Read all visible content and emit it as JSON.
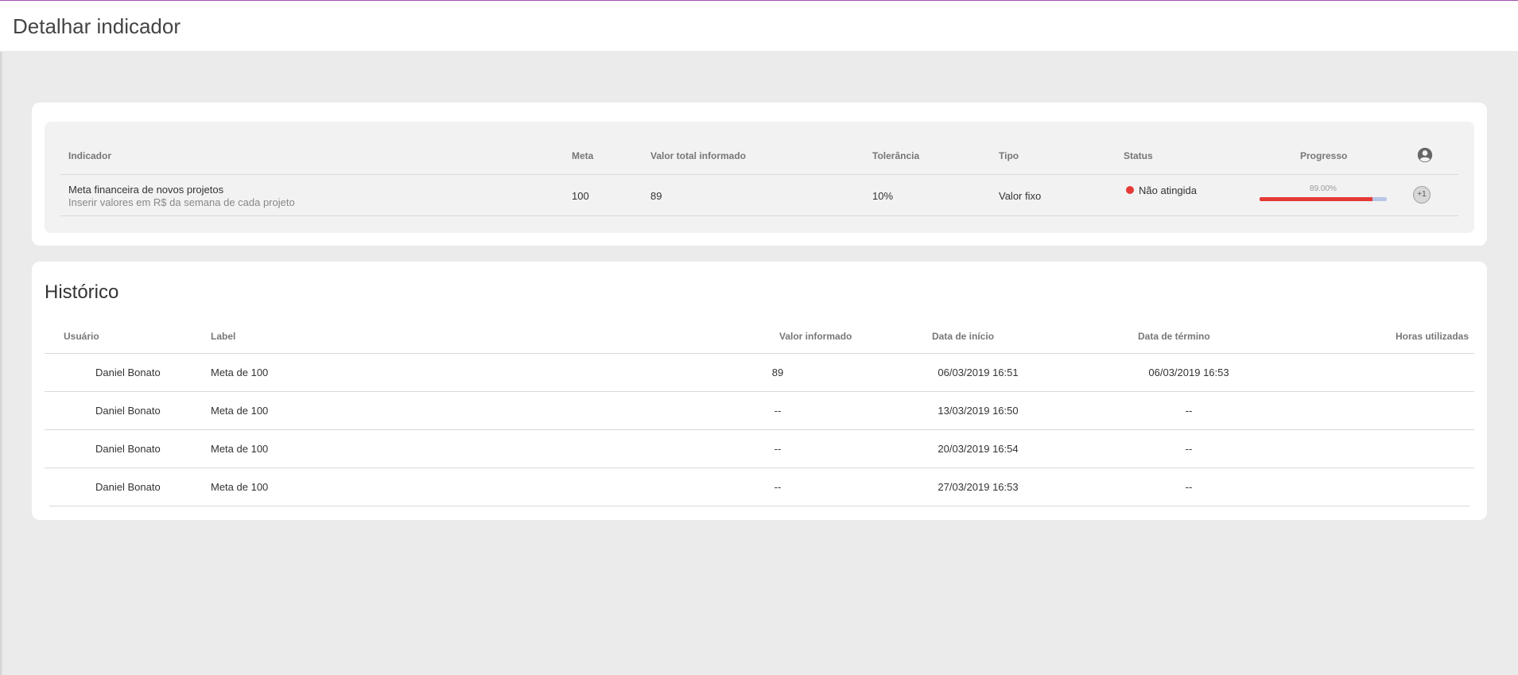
{
  "header": {
    "title": "Detalhar indicador"
  },
  "indicator_table": {
    "columns": {
      "indicador": "Indicador",
      "meta": "Meta",
      "valor_total": "Valor total informado",
      "tolerancia": "Tolerância",
      "tipo": "Tipo",
      "status": "Status",
      "progresso": "Progresso"
    },
    "row": {
      "name": "Meta financeira de novos projetos",
      "description": "Inserir valores em R$ da semana de cada projeto",
      "meta": "100",
      "valor_total": "89",
      "tolerancia": "10%",
      "tipo": "Valor fixo",
      "status": "Não atingida",
      "status_color": "#e53935",
      "progress_label": "89.00%",
      "progress_value": 0.89,
      "responsibles_extra": "+1"
    },
    "icons": {
      "responsible": "account-circle-icon"
    }
  },
  "history": {
    "title": "Histórico",
    "columns": {
      "usuario": "Usuário",
      "label": "Label",
      "valor": "Valor informado",
      "inicio": "Data de início",
      "termino": "Data de término",
      "horas": "Horas utilizadas"
    },
    "rows": [
      {
        "usuario": "Daniel Bonato",
        "label": "Meta de 100",
        "valor": "89",
        "inicio": "06/03/2019 16:51",
        "termino": "06/03/2019 16:53",
        "horas": ""
      },
      {
        "usuario": "Daniel Bonato",
        "label": "Meta de 100",
        "valor": "--",
        "inicio": "13/03/2019 16:50",
        "termino": "--",
        "horas": ""
      },
      {
        "usuario": "Daniel Bonato",
        "label": "Meta de 100",
        "valor": "--",
        "inicio": "20/03/2019 16:54",
        "termino": "--",
        "horas": ""
      },
      {
        "usuario": "Daniel Bonato",
        "label": "Meta de 100",
        "valor": "--",
        "inicio": "27/03/2019 16:53",
        "termino": "--",
        "horas": ""
      }
    ]
  }
}
